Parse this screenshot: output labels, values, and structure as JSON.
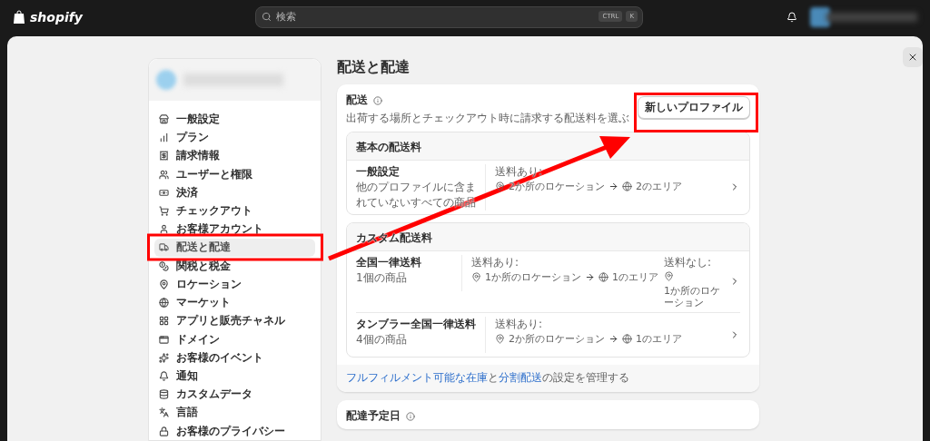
{
  "topbar": {
    "logo": "shopify",
    "search": {
      "placeholder": "検索",
      "shortcut": [
        "CTRL",
        "K"
      ]
    }
  },
  "sidebar": {
    "items": [
      {
        "label": "一般設定",
        "selected": false
      },
      {
        "label": "プラン",
        "selected": false
      },
      {
        "label": "請求情報",
        "selected": false
      },
      {
        "label": "ユーザーと権限",
        "selected": false
      },
      {
        "label": "決済",
        "selected": false
      },
      {
        "label": "チェックアウト",
        "selected": false
      },
      {
        "label": "お客様アカウント",
        "selected": false
      },
      {
        "label": "配送と配達",
        "selected": true
      },
      {
        "label": "関税と税金",
        "selected": false
      },
      {
        "label": "ロケーション",
        "selected": false
      },
      {
        "label": "マーケット",
        "selected": false
      },
      {
        "label": "アプリと販売チャネル",
        "selected": false
      },
      {
        "label": "ドメイン",
        "selected": false
      },
      {
        "label": "お客様のイベント",
        "selected": false
      },
      {
        "label": "通知",
        "selected": false
      },
      {
        "label": "カスタムデータ",
        "selected": false
      },
      {
        "label": "言語",
        "selected": false
      },
      {
        "label": "お客様のプライバシー",
        "selected": false
      }
    ]
  },
  "page": {
    "title": "配送と配達"
  },
  "shipping": {
    "title": "配送",
    "description": "出荷する場所とチェックアウト時に請求する配送料を選ぶ",
    "button": "新しいプロファイル",
    "sections": [
      {
        "title": "基本の配送料",
        "profiles": [
          {
            "name": "一般設定",
            "sub": "他のプロファイルに含まれていないすべての商品",
            "rates": [
              {
                "kind": "inline",
                "label": "送料あり:",
                "locations": "2か所のロケーション",
                "areas": "2のエリア"
              }
            ]
          }
        ]
      },
      {
        "title": "カスタム配送料",
        "profiles": [
          {
            "name": "全国一律送料",
            "sub": "1個の商品",
            "rates": [
              {
                "kind": "inline",
                "label": "送料あり:",
                "locations": "1か所のロケーション",
                "areas": "1のエリア"
              },
              {
                "kind": "stacked",
                "label": "送料なし:",
                "locations": "1か所のロケーション"
              }
            ]
          },
          {
            "name": "タンブラー全国一律送料",
            "sub": "4個の商品",
            "rates": [
              {
                "kind": "inline",
                "label": "送料あり:",
                "locations": "2か所のロケーション",
                "areas": "1のエリア"
              }
            ]
          }
        ]
      }
    ],
    "footer": [
      {
        "text": "フルフィルメント可能な在庫",
        "link": true
      },
      {
        "text": "と",
        "link": false
      },
      {
        "text": "分割配送",
        "link": true
      },
      {
        "text": "の設定を管理する",
        "link": false
      }
    ]
  },
  "delivery": {
    "title": "配達予定日"
  }
}
